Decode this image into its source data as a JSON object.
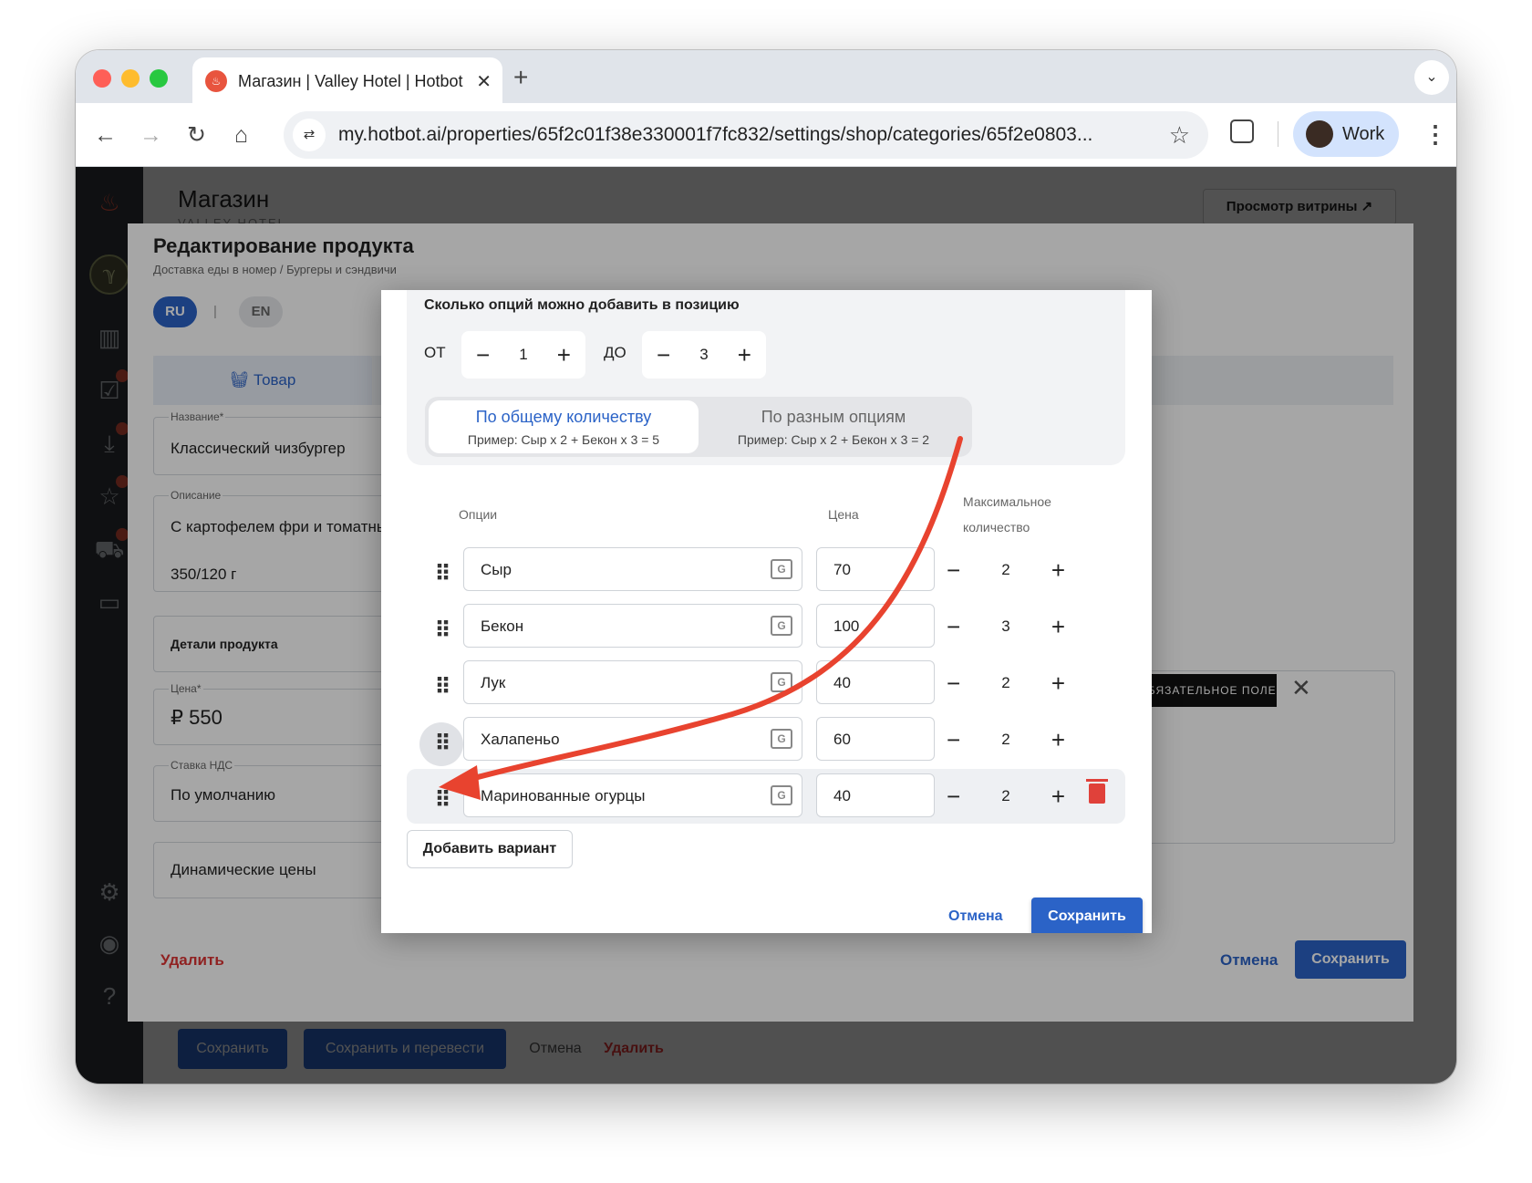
{
  "browser": {
    "tab_title": "Магазин | Valley Hotel | Hotbot",
    "tab_close": "✕",
    "new_tab": "+",
    "tab_menu": "⌄",
    "url": "my.hotbot.ai/properties/65f2c01f38e330001f7fc832/settings/shop/categories/65f2e0803...",
    "profile_label": "Work",
    "nav": {
      "back": "←",
      "forward": "→",
      "reload": "↻",
      "home": "⌂",
      "star": "☆",
      "menu": "⋮",
      "site_info": "⇄"
    }
  },
  "page": {
    "title": "Магазин",
    "subtitle": "VALLEY HOTEL",
    "showcase_button": "Просмотр витрины ↗",
    "bottom_actions": {
      "save": "Сохранить",
      "save_translate": "Сохранить и перевести",
      "cancel": "Отмена",
      "delete": "Удалить"
    }
  },
  "product_dialog": {
    "title": "Редактирование продукта",
    "breadcrumb": "Доставка еды в номер / Бургеры и сэндвичи",
    "languages": [
      "RU",
      "EN"
    ],
    "lang_separator": "|",
    "active_language": "RU",
    "tab_label": "Товар",
    "fields": {
      "name_label": "Название*",
      "name_value": "Классический чизбургер",
      "description_label": "Описание",
      "description_line1": "С картофелем фри и томатны",
      "description_line2": "350/120 г",
      "details_label": "Детали продукта",
      "price_label": "Цена*",
      "price_value": "₽ 550",
      "vat_label": "Ставка НДС",
      "vat_value": "По умолчанию",
      "dynamic_prices": "Динамические цены"
    },
    "required_badge": "ОБЯЗАТЕЛЬНОЕ ПОЛЕ",
    "required_close": "✕",
    "delete": "Удалить",
    "cancel": "Отмена",
    "save": "Сохранить"
  },
  "options_modal": {
    "question": "Сколько опций можно добавить в позицию",
    "from_label": "ОТ",
    "from_value": "1",
    "to_label": "ДО",
    "to_value": "3",
    "minus": "−",
    "plus": "+",
    "modes": [
      {
        "label": "По общему количеству",
        "example": "Пример: Сыр х 2 + Бекон х 3 = 5",
        "active": true
      },
      {
        "label": "По разным опциям",
        "example": "Пример: Сыр х 2 + Бекон х 3 = 2",
        "active": false
      }
    ],
    "columns": {
      "options": "Опции",
      "price": "Цена",
      "max_qty_line1": "Максимальное",
      "max_qty_line2": "количество"
    },
    "handle_glyph": "⠿",
    "translate_glyph": "G",
    "rows": [
      {
        "name": "Сыр",
        "price": "70",
        "max": "2"
      },
      {
        "name": "Бекон",
        "price": "100",
        "max": "3"
      },
      {
        "name": "Лук",
        "price": "40",
        "max": "2"
      },
      {
        "name": "Халапеньо",
        "price": "60",
        "max": "2"
      },
      {
        "name": "Маринованные огурцы",
        "price": "40",
        "max": "2"
      }
    ],
    "add_variant": "Добавить вариант",
    "cancel": "Отмена",
    "save": "Сохранить"
  },
  "colors": {
    "accent": "#2b63c7",
    "danger": "#e0413a",
    "annotation_arrow": "#e8432f"
  }
}
